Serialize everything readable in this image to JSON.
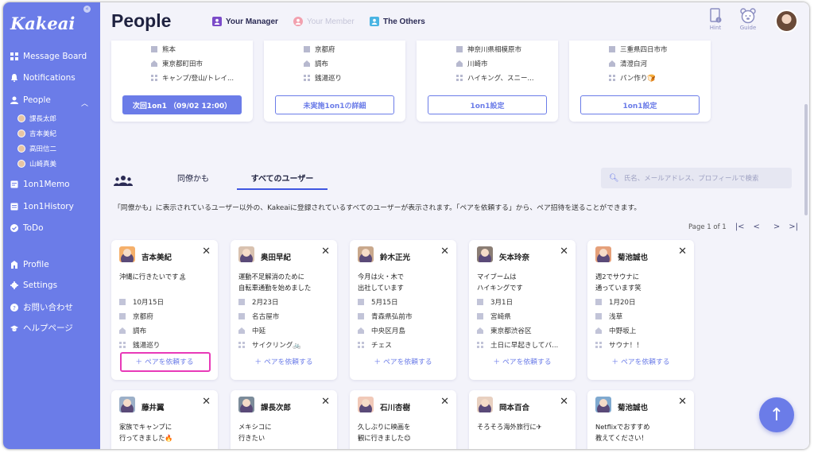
{
  "app": {
    "logo": "Kakeai"
  },
  "sidebar": {
    "items": [
      {
        "label": "Message Board",
        "icon": "board-icon"
      },
      {
        "label": "Notifications",
        "icon": "bell-icon"
      },
      {
        "label": "People",
        "icon": "person-icon"
      },
      {
        "label": "1on1Memo",
        "icon": "memo-icon"
      },
      {
        "label": "1on1History",
        "icon": "history-icon"
      },
      {
        "label": "ToDo",
        "icon": "check-circle-icon"
      },
      {
        "label": "Profile",
        "icon": "building-icon"
      },
      {
        "label": "Settings",
        "icon": "gear-icon"
      },
      {
        "label": "お問い合わせ",
        "icon": "help-icon"
      },
      {
        "label": "ヘルプページ",
        "icon": "graduation-cap-icon"
      }
    ],
    "people_sub": [
      "課長太郎",
      "吉本美紀",
      "高田信二",
      "山崎真美"
    ]
  },
  "header": {
    "title": "People",
    "filters": [
      {
        "label": "Your Manager",
        "color": "#7b4bc9",
        "active": true
      },
      {
        "label": "Your Member",
        "color": "#f2a0ae",
        "active": false
      },
      {
        "label": "The Others",
        "color": "#49b4e3",
        "active": true
      }
    ],
    "hint": "Hint",
    "guide": "Guide"
  },
  "top_cards": [
    {
      "rows": [
        "熊本",
        "東京都町田市",
        "キャンプ/登山/トレイ..."
      ],
      "button": "次回1on1 （09/02 12:00）",
      "button_style": "filled"
    },
    {
      "rows": [
        "京都府",
        "調布",
        "銭湯巡り"
      ],
      "button": "未実施1on1の詳細",
      "button_style": "outline"
    },
    {
      "rows": [
        "神奈川県相模原市",
        "川崎市",
        "ハイキング、スニー..."
      ],
      "button": "1on1設定",
      "button_style": "outline"
    },
    {
      "rows": [
        "三重県四日市市",
        "清澄白河",
        "パン作り🍞"
      ],
      "button": "1on1設定",
      "button_style": "outline"
    }
  ],
  "main": {
    "tabs": [
      "同僚かも",
      "すべてのユーザー"
    ],
    "active_tab": 1,
    "search_placeholder": "氏名、メールアドレス、プロフィールで検索",
    "info": "「同僚かも」に表示されているユーザー以外の、Kakeaiに登録されているすべてのユーザーが表示されます。「ペアを依頼する」から、ペア招待を送ることができます。",
    "pager": "Page 1 of 1"
  },
  "people": [
    {
      "name": "吉本美紀",
      "msg": [
        "沖縄に行きたいです🏝"
      ],
      "rows": [
        "10月15日",
        "京都府",
        "調布",
        "銭湯巡り"
      ],
      "pair": "＋ ペアを依頼する",
      "highlight": true
    },
    {
      "name": "奥田早紀",
      "msg": [
        "運動不足解消のために",
        "自転車通勤を始めました"
      ],
      "rows": [
        "2月23日",
        "名古屋市",
        "中延",
        "サイクリング🚲"
      ],
      "pair": "＋ ペアを依頼する"
    },
    {
      "name": "鈴木正光",
      "msg": [
        "今月は火・木で",
        "出社しています"
      ],
      "rows": [
        "5月15日",
        "青森県弘前市",
        "中央区月島",
        "チェス"
      ],
      "pair": "＋ ペアを依頼する"
    },
    {
      "name": "矢本玲奈",
      "msg": [
        "マイブームは",
        "ハイキングです"
      ],
      "rows": [
        "3月1日",
        "宮崎県",
        "東京都渋谷区",
        "土日に早起きしてバ..."
      ],
      "pair": "＋ ペアを依頼する"
    },
    {
      "name": "菊池誠也",
      "msg": [
        "週2でサウナに",
        "通っています笑"
      ],
      "rows": [
        "1月20日",
        "浅草",
        "中野坂上",
        "サウナ！！"
      ],
      "pair": "＋ ペアを依頼する"
    },
    {
      "name": "藤井翼",
      "msg": [
        "家族でキャンプに",
        "行ってきました🔥"
      ]
    },
    {
      "name": "課長次郎",
      "msg": [
        "メキシコに",
        "行きたい"
      ]
    },
    {
      "name": "石川杏樹",
      "msg": [
        "久しぶりに映画を",
        "観に行きました😊"
      ]
    },
    {
      "name": "岡本百合",
      "msg": [
        "そろそろ海外旅行に✈"
      ]
    },
    {
      "name": "菊池誠也",
      "msg": [
        "Netflixでおすすめ",
        "教えてください！"
      ]
    }
  ]
}
